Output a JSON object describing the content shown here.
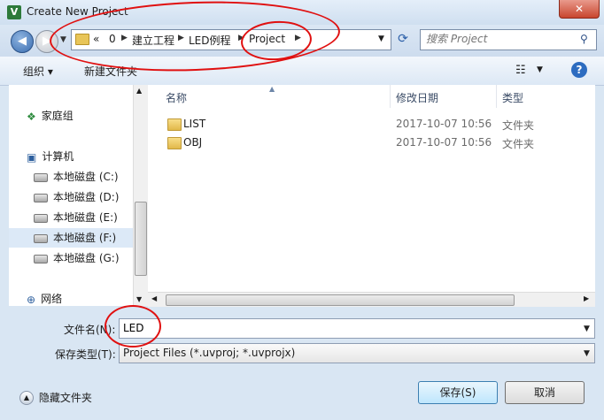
{
  "window": {
    "title": "Create New Project",
    "app_icon": "V",
    "close_label": "✕"
  },
  "address": {
    "prefix": "«",
    "crumbs": [
      "0",
      "建立工程",
      "LED例程",
      "Project"
    ]
  },
  "search": {
    "placeholder": "搜索 Project"
  },
  "toolbar": {
    "organize": "组织 ▾",
    "new_folder": "新建文件夹",
    "help": "?"
  },
  "nav": {
    "homegroup": "家庭组",
    "computer": "计算机",
    "drives": [
      "本地磁盘 (C:)",
      "本地磁盘 (D:)",
      "本地磁盘 (E:)",
      "本地磁盘 (F:)",
      "本地磁盘 (G:)"
    ],
    "network": "网络"
  },
  "columns": {
    "name": "名称",
    "date": "修改日期",
    "type": "类型"
  },
  "files": [
    {
      "name": "LIST",
      "date": "2017-10-07 10:56",
      "type": "文件夹"
    },
    {
      "name": "OBJ",
      "date": "2017-10-07 10:56",
      "type": "文件夹"
    }
  ],
  "form": {
    "filename_label": "文件名(N):",
    "filename_value": "LED",
    "filetype_label": "保存类型(T):",
    "filetype_value": "Project Files (*.uvproj; *.uvprojx)"
  },
  "footer": {
    "hide_folders": "隐藏文件夹",
    "save": "保存(S)",
    "cancel": "取消"
  },
  "colors": {
    "annotation": "#e01010",
    "accent": "#2d6cc0"
  }
}
